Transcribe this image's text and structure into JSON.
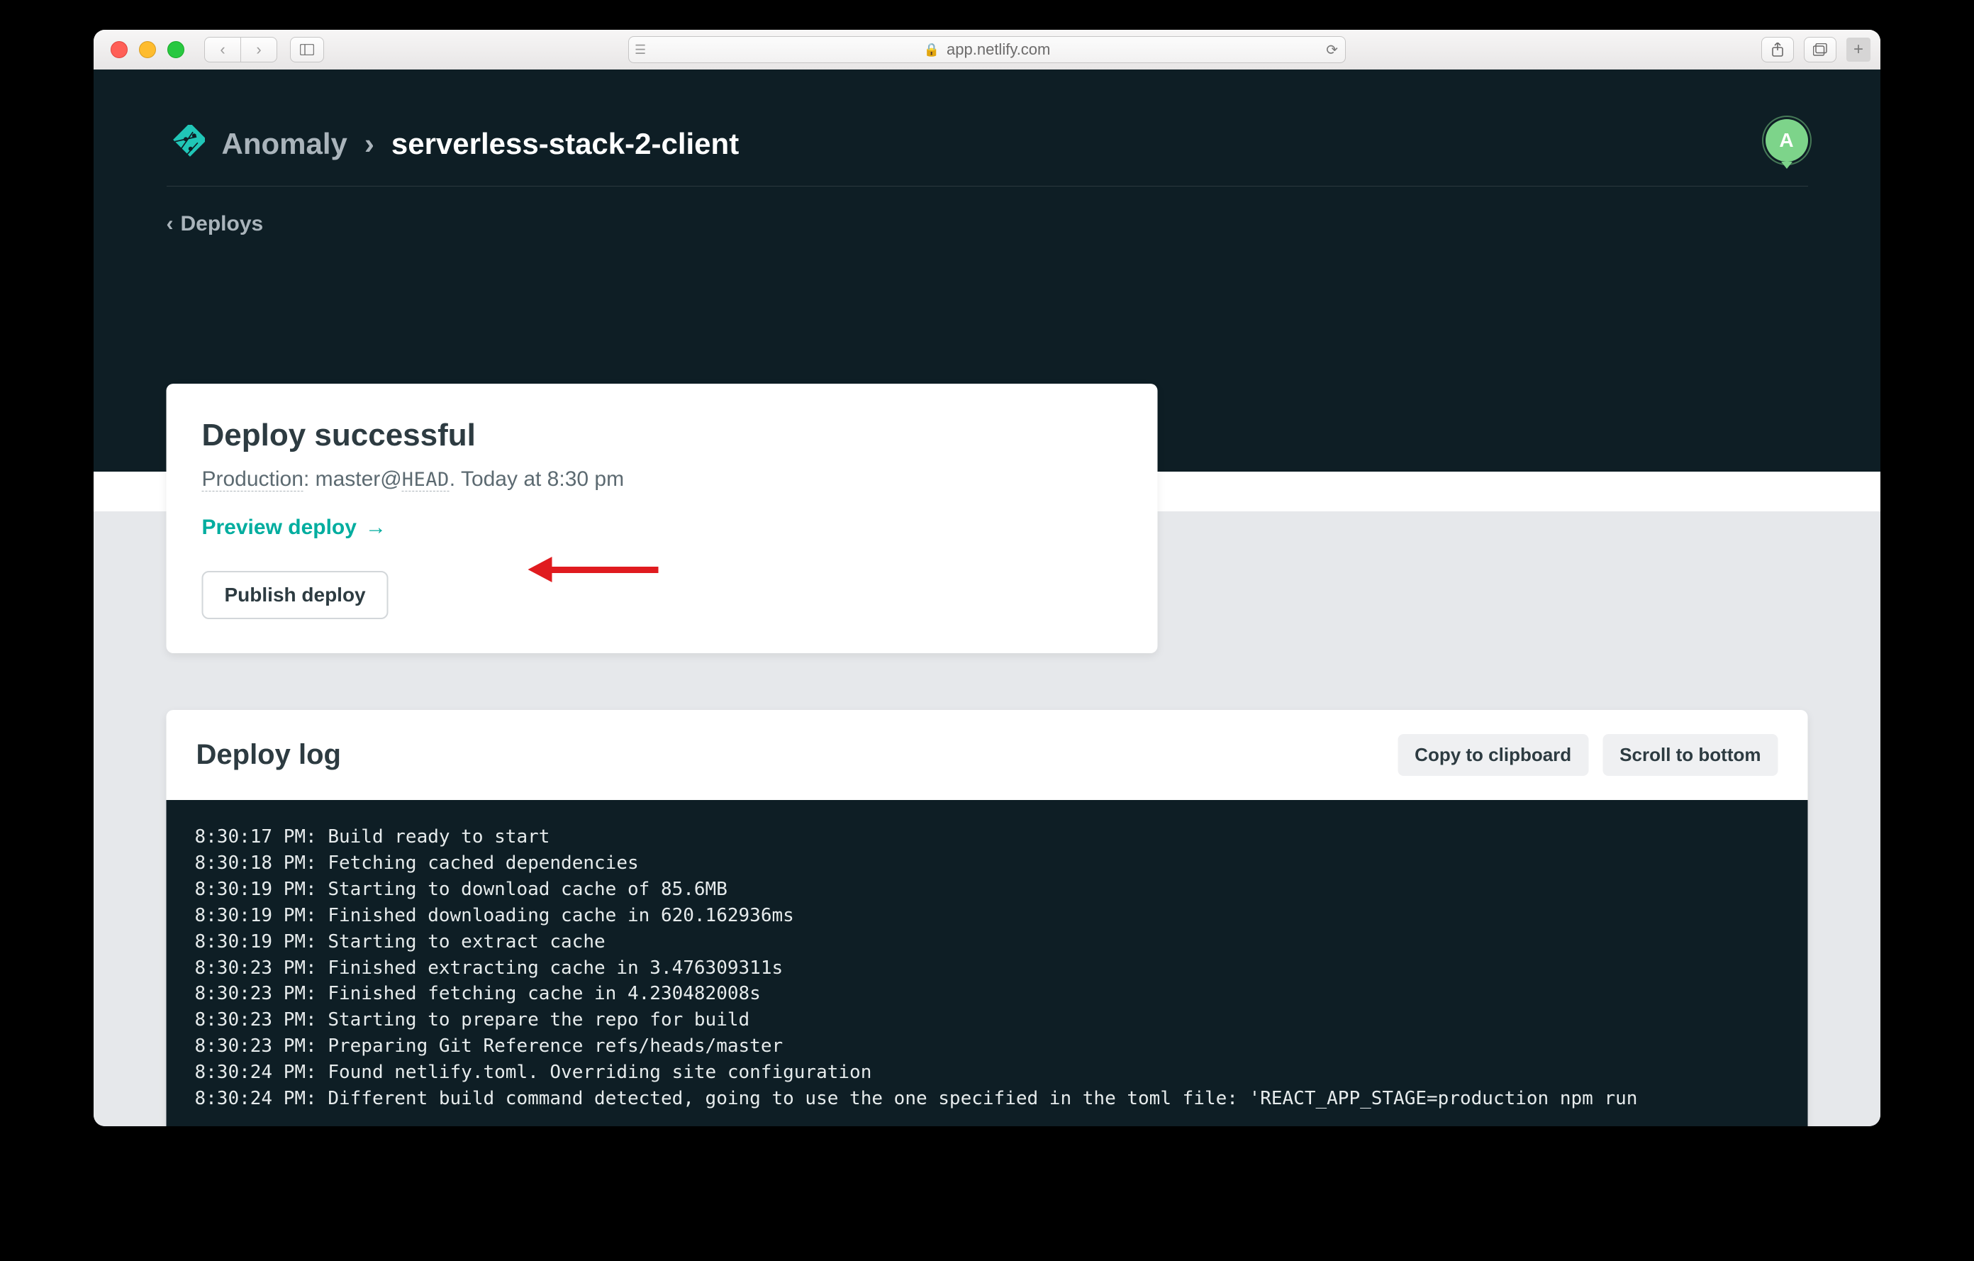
{
  "browser": {
    "url_host": "app.netlify.com"
  },
  "breadcrumb": {
    "org": "Anomaly",
    "project": "serverless-stack-2-client"
  },
  "avatar_initial": "A",
  "back_link": "Deploys",
  "card": {
    "title": "Deploy successful",
    "env_label": "Production",
    "branch": "master",
    "ref": "HEAD",
    "time_text": "Today at 8:30 pm",
    "preview_label": "Preview deploy",
    "publish_label": "Publish deploy"
  },
  "log": {
    "heading": "Deploy log",
    "copy_label": "Copy to clipboard",
    "scroll_label": "Scroll to bottom",
    "lines": [
      "8:30:17 PM: Build ready to start",
      "8:30:18 PM: Fetching cached dependencies",
      "8:30:19 PM: Starting to download cache of 85.6MB",
      "8:30:19 PM: Finished downloading cache in 620.162936ms",
      "8:30:19 PM: Starting to extract cache",
      "8:30:23 PM: Finished extracting cache in 3.476309311s",
      "8:30:23 PM: Finished fetching cache in 4.230482008s",
      "8:30:23 PM: Starting to prepare the repo for build",
      "8:30:23 PM: Preparing Git Reference refs/heads/master",
      "8:30:24 PM: Found netlify.toml. Overriding site configuration",
      "8:30:24 PM: Different build command detected, going to use the one specified in the toml file: 'REACT_APP_STAGE=production npm run"
    ]
  }
}
